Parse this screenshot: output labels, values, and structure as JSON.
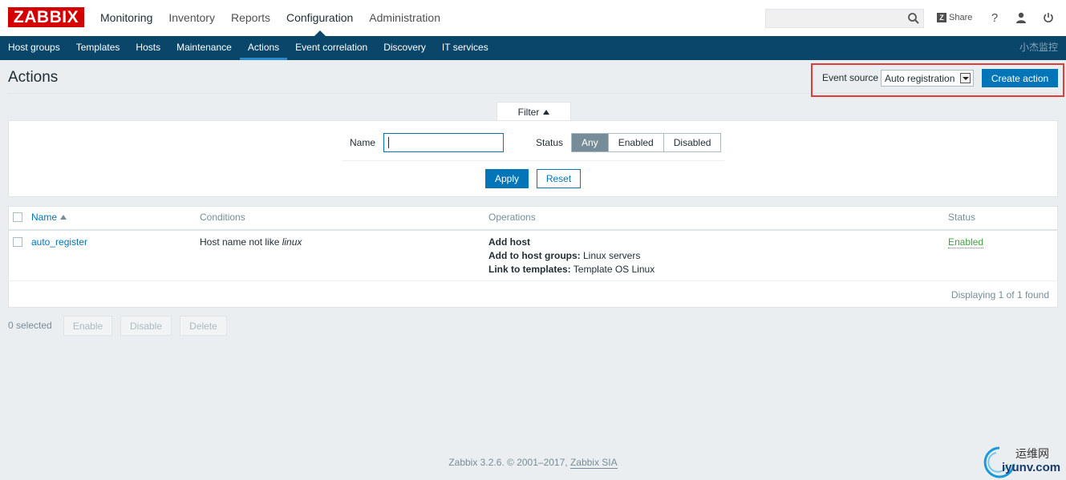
{
  "header": {
    "logo_text": "ZABBIX",
    "menu": [
      {
        "label": "Monitoring"
      },
      {
        "label": "Inventory"
      },
      {
        "label": "Reports"
      },
      {
        "label": "Configuration"
      },
      {
        "label": "Administration"
      }
    ],
    "search_value": "",
    "share_label": "Share",
    "help_glyph": "?"
  },
  "subnav": {
    "items": [
      {
        "label": "Host groups"
      },
      {
        "label": "Templates"
      },
      {
        "label": "Hosts"
      },
      {
        "label": "Maintenance"
      },
      {
        "label": "Actions"
      },
      {
        "label": "Event correlation"
      },
      {
        "label": "Discovery"
      },
      {
        "label": "IT services"
      }
    ],
    "active": "Actions",
    "server_name": "小杰监控"
  },
  "page": {
    "title": "Actions",
    "event_source_label": "Event source",
    "event_source_value": "Auto registration",
    "create_button": "Create action"
  },
  "filter": {
    "tab_label": "Filter",
    "name_label": "Name",
    "name_value": "",
    "status_label": "Status",
    "status_options": [
      "Any",
      "Enabled",
      "Disabled"
    ],
    "status_selected": "Any",
    "apply_label": "Apply",
    "reset_label": "Reset"
  },
  "table": {
    "columns": {
      "name": "Name",
      "conditions": "Conditions",
      "operations": "Operations",
      "status": "Status"
    },
    "rows": [
      {
        "name": "auto_register",
        "condition_text": "Host name not like ",
        "condition_value": "linux",
        "operations": [
          {
            "label": "Add host",
            "value": ""
          },
          {
            "label": "Add to host groups:",
            "value": " Linux servers"
          },
          {
            "label": "Link to templates:",
            "value": " Template OS Linux"
          }
        ],
        "status": "Enabled"
      }
    ],
    "displaying": "Displaying 1 of 1 found"
  },
  "bulk": {
    "selected": "0 selected",
    "enable": "Enable",
    "disable": "Disable",
    "delete": "Delete"
  },
  "footer": {
    "text": "Zabbix 3.2.6. © 2001–2017, ",
    "link": "Zabbix SIA"
  },
  "watermark": {
    "cn": "运维网",
    "en": "iyunv.com"
  },
  "colors": {
    "brand_red": "#d40000",
    "nav_dark": "#0a466a",
    "primary_blue": "#0275b8",
    "status_green": "#429e47",
    "highlight_red": "#e03c3c"
  },
  "icons": [
    "search-icon",
    "share-z-icon",
    "help-icon",
    "user-icon",
    "power-icon",
    "chevron-down-icon",
    "sort-up-icon"
  ]
}
